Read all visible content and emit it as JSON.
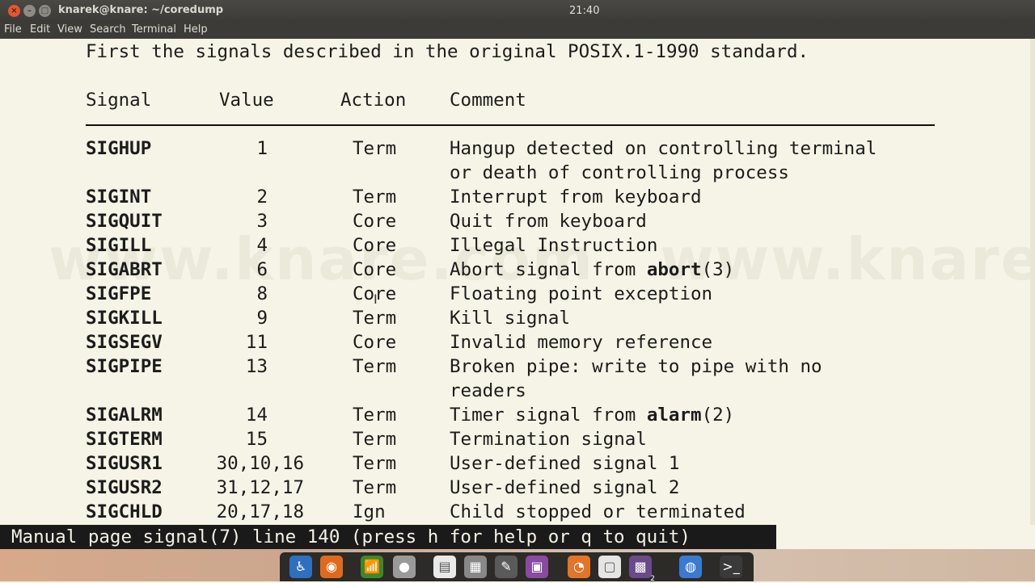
{
  "window": {
    "title": "knarek@knare: ~/coredump",
    "clock": "21:40",
    "close_glyph": "×",
    "min_glyph": "–",
    "max_glyph": "□"
  },
  "menu": [
    "File",
    "Edit",
    "View",
    "Search",
    "Terminal",
    "Help"
  ],
  "man": {
    "intro": "First the signals described in the original POSIX.1-1990 standard.",
    "headers": {
      "signal": "Signal",
      "value": "Value",
      "action": "Action",
      "comment": "Comment"
    },
    "rows": [
      {
        "signal": "SIGHUP",
        "value": "1",
        "action": "Term",
        "comment": "Hangup detected on controlling terminal",
        "comment2": "or death of controlling process"
      },
      {
        "signal": "SIGINT",
        "value": "2",
        "action": "Term",
        "comment": "Interrupt from keyboard"
      },
      {
        "signal": "SIGQUIT",
        "value": "3",
        "action": "Core",
        "comment": "Quit from keyboard"
      },
      {
        "signal": "SIGILL",
        "value": "4",
        "action": "Core",
        "comment": "Illegal Instruction"
      },
      {
        "signal": "SIGABRT",
        "value": "6",
        "action": "Core",
        "comment_pre": "Abort signal from ",
        "comment_bold": "abort",
        "comment_post": "(3)"
      },
      {
        "signal": "SIGFPE",
        "value": "8",
        "action": "Core",
        "comment": "Floating point exception"
      },
      {
        "signal": "SIGKILL",
        "value": "9",
        "action": "Term",
        "comment": "Kill signal"
      },
      {
        "signal": "SIGSEGV",
        "value": "11",
        "action": "Core",
        "comment": "Invalid memory reference"
      },
      {
        "signal": "SIGPIPE",
        "value": "13",
        "action": "Term",
        "comment": "Broken pipe: write to pipe with no",
        "comment2": "readers"
      },
      {
        "signal": "SIGALRM",
        "value": "14",
        "action": "Term",
        "comment_pre": "Timer signal from ",
        "comment_bold": "alarm",
        "comment_post": "(2)"
      },
      {
        "signal": "SIGTERM",
        "value": "15",
        "action": "Term",
        "comment": "Termination signal"
      },
      {
        "signal": "SIGUSR1",
        "value": "30,10,16",
        "action": "Term",
        "comment": "User-defined signal 1"
      },
      {
        "signal": "SIGUSR2",
        "value": "31,12,17",
        "action": "Term",
        "comment": "User-defined signal 2"
      },
      {
        "signal": "SIGCHLD",
        "value": "20,17,18",
        "action": "Ign",
        "comment": "Child stopped or terminated"
      }
    ],
    "status": "Manual page signal(7) line 140 (press h for help or q to quit)"
  },
  "watermark": "www.knare.com   www.knare",
  "cursor": "I",
  "dock": [
    {
      "name": "accessibility-icon",
      "glyph": "♿",
      "color": "#2f6fc0"
    },
    {
      "name": "firefox-icon",
      "glyph": "◉",
      "color": "#e06a1c"
    },
    {
      "name": "network-icon",
      "glyph": "📶",
      "color": "#3a8a2a"
    },
    {
      "name": "disk-icon",
      "glyph": "●",
      "color": "#9a9a9a"
    },
    {
      "name": "document-icon",
      "glyph": "▤",
      "color": "#e9e9e9"
    },
    {
      "name": "calculator-icon",
      "glyph": "▦",
      "color": "#888888"
    },
    {
      "name": "gimp-icon",
      "glyph": "✎",
      "color": "#5a5a5a"
    },
    {
      "name": "screenshot-icon",
      "glyph": "▣",
      "color": "#8a4aa0"
    },
    {
      "name": "folder-icon",
      "glyph": "◔",
      "color": "#e2752a"
    },
    {
      "name": "window-icon",
      "glyph": "▢",
      "color": "#e5e5e5"
    },
    {
      "name": "workspace-icon",
      "glyph": "▩",
      "color": "#6a4a8a"
    },
    {
      "name": "chrome-icon",
      "glyph": "◍",
      "color": "#3a7ad0"
    },
    {
      "name": "terminal-icon",
      "glyph": ">_",
      "color": "#3a3a3a"
    }
  ],
  "dock_badge": "2"
}
